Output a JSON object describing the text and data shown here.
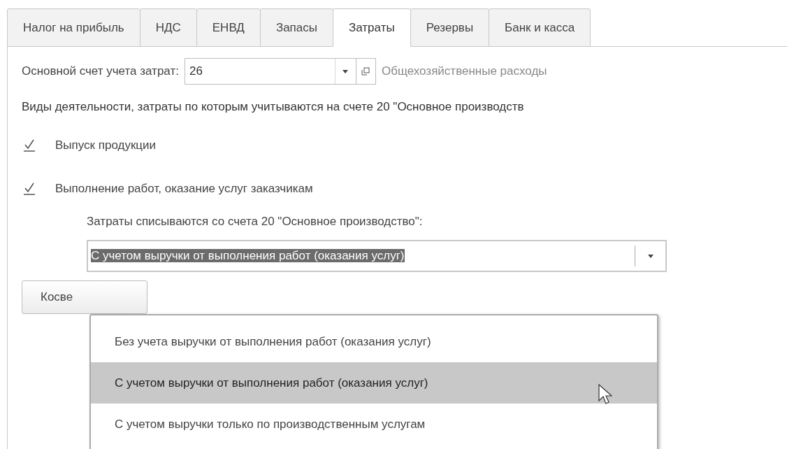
{
  "tabs": [
    {
      "label": "Налог на прибыль",
      "selected": false
    },
    {
      "label": "НДС",
      "selected": false
    },
    {
      "label": "ЕНВД",
      "selected": false
    },
    {
      "label": "Запасы",
      "selected": false
    },
    {
      "label": "Затраты",
      "selected": true
    },
    {
      "label": "Резервы",
      "selected": false
    },
    {
      "label": "Банк и касса",
      "selected": false
    }
  ],
  "main_account": {
    "label": "Основной счет учета затрат:",
    "value": "26",
    "description": "Общехозяйственные расходы"
  },
  "activities_heading": "Виды деятельности, затраты по которым учитываются на счете 20 \"Основное производств",
  "activities": [
    {
      "label": "Выпуск продукции",
      "checked": true
    },
    {
      "label": "Выполнение работ, оказание услуг заказчикам",
      "checked": true
    }
  ],
  "writeoff": {
    "label": "Затраты списываются со счета 20 \"Основное производство\":",
    "value": "С учетом выручки от выполнения работ (оказания услуг)",
    "options": [
      {
        "label": "Без учета выручки от выполнения работ (оказания услуг)",
        "selected": false
      },
      {
        "label": "С учетом выручки от выполнения работ (оказания услуг)",
        "selected": true
      },
      {
        "label": "С учетом выручки только по производственным услугам",
        "selected": false
      }
    ]
  },
  "indirect_button": "Косве"
}
